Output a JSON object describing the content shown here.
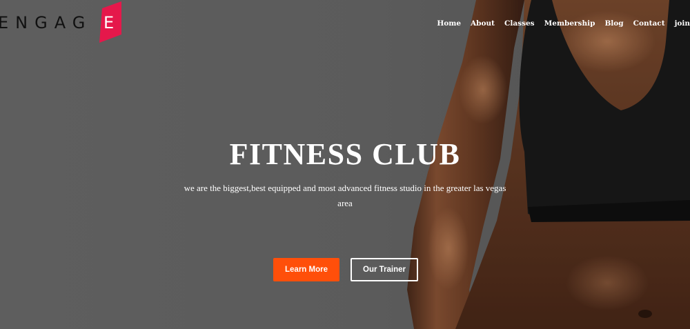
{
  "brand": {
    "name_main": "ENGAG",
    "name_accent": "E",
    "accent_color": "#e5184b"
  },
  "nav": {
    "items": [
      "Home",
      "About",
      "Classes",
      "Membership",
      "Blog",
      "Contact",
      "join"
    ]
  },
  "hero": {
    "title": "FITNESS CLUB",
    "description": "we are the biggest,best equipped and most advanced fitness studio in the greater las vegas area",
    "primary_button": "Learn More",
    "secondary_button": "Our Trainer",
    "primary_color": "#ff4f0a"
  }
}
